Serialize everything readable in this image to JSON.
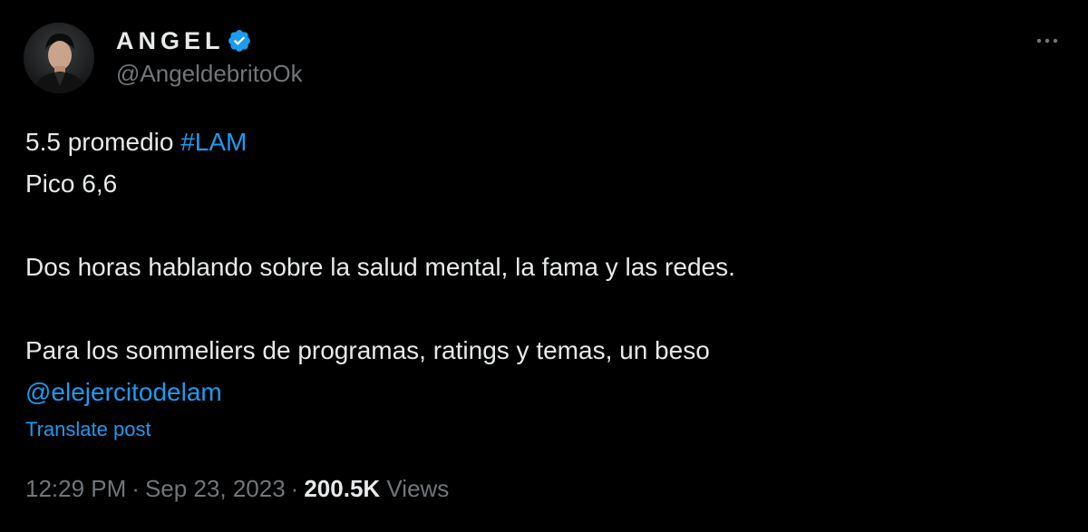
{
  "author": {
    "display_name": "ANGEL",
    "handle": "@AngeldebritoOk",
    "verified": true,
    "avatar_icon": "profile-photo"
  },
  "post": {
    "line1_text": "5.5 promedio ",
    "line1_hashtag": "#LAM",
    "line2": "Pico 6,6",
    "line3": "Dos horas hablando sobre la salud mental, la fama y las redes.",
    "line4": "Para los sommeliers de programas, ratings y temas, un beso",
    "mention": "@elejercitodelam"
  },
  "translate_label": "Translate post",
  "meta": {
    "time": "12:29 PM",
    "separator": "·",
    "date": "Sep 23, 2023",
    "views_count": "200.5K",
    "views_label": "Views"
  },
  "colors": {
    "background": "#000000",
    "text": "#e7e9ea",
    "secondary": "#71767b",
    "accent": "#1d9bf0"
  },
  "icons": {
    "more": "more-options-icon",
    "verified": "verified-badge-icon"
  }
}
